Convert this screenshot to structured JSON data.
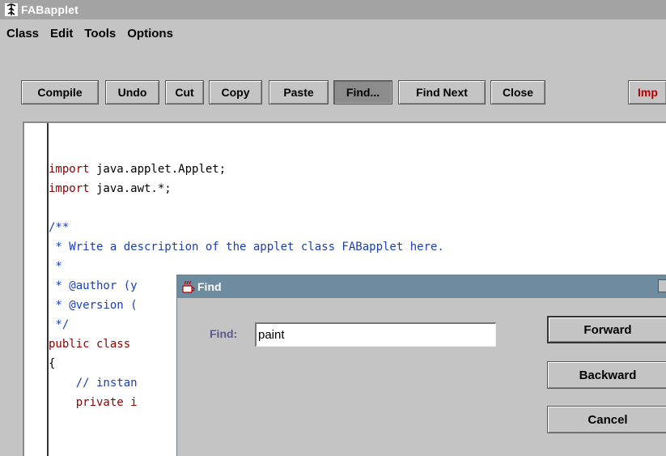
{
  "window": {
    "title": "FABapplet"
  },
  "menu": [
    "Class",
    "Edit",
    "Tools",
    "Options"
  ],
  "toolbar": {
    "buttons": [
      "Compile",
      "Undo",
      "Cut",
      "Copy",
      "Paste",
      "Find...",
      "Find Next",
      "Close"
    ],
    "active": "Find...",
    "partial_label": "Imp"
  },
  "editor": {
    "lines": [
      {
        "parts": [
          {
            "t": "import",
            "c": "kw"
          },
          {
            "t": " java.applet.Applet;",
            "c": ""
          }
        ]
      },
      {
        "parts": [
          {
            "t": "import",
            "c": "kw"
          },
          {
            "t": " java.awt.*;",
            "c": ""
          }
        ]
      },
      {
        "parts": [
          {
            "t": "",
            "c": ""
          }
        ]
      },
      {
        "parts": [
          {
            "t": "/**",
            "c": "cm"
          }
        ]
      },
      {
        "parts": [
          {
            "t": " * Write a description of the applet class FABapplet here.",
            "c": "cm"
          }
        ]
      },
      {
        "parts": [
          {
            "t": " *",
            "c": "cm"
          }
        ]
      },
      {
        "parts": [
          {
            "t": " * @author (y",
            "c": "cm"
          }
        ]
      },
      {
        "parts": [
          {
            "t": " * @version (",
            "c": "cm"
          }
        ]
      },
      {
        "parts": [
          {
            "t": " */",
            "c": "cm"
          }
        ]
      },
      {
        "parts": [
          {
            "t": "public class",
            "c": "kw"
          }
        ]
      },
      {
        "parts": [
          {
            "t": "{",
            "c": ""
          }
        ]
      },
      {
        "parts": [
          {
            "t": "    // instan",
            "c": "cm"
          }
        ]
      },
      {
        "parts": [
          {
            "t": "    private i",
            "c": "kw"
          }
        ]
      }
    ]
  },
  "find_dialog": {
    "title": "Find",
    "find_label": "Find:",
    "find_value": "paint",
    "buttons": {
      "forward": "Forward",
      "backward": "Backward",
      "cancel": "Cancel"
    }
  },
  "colors": {
    "keyword": "#8b0000",
    "comment": "#1a3fb0",
    "dialog_title": "#6e8ca0",
    "window_title": "#a3a3a3"
  }
}
